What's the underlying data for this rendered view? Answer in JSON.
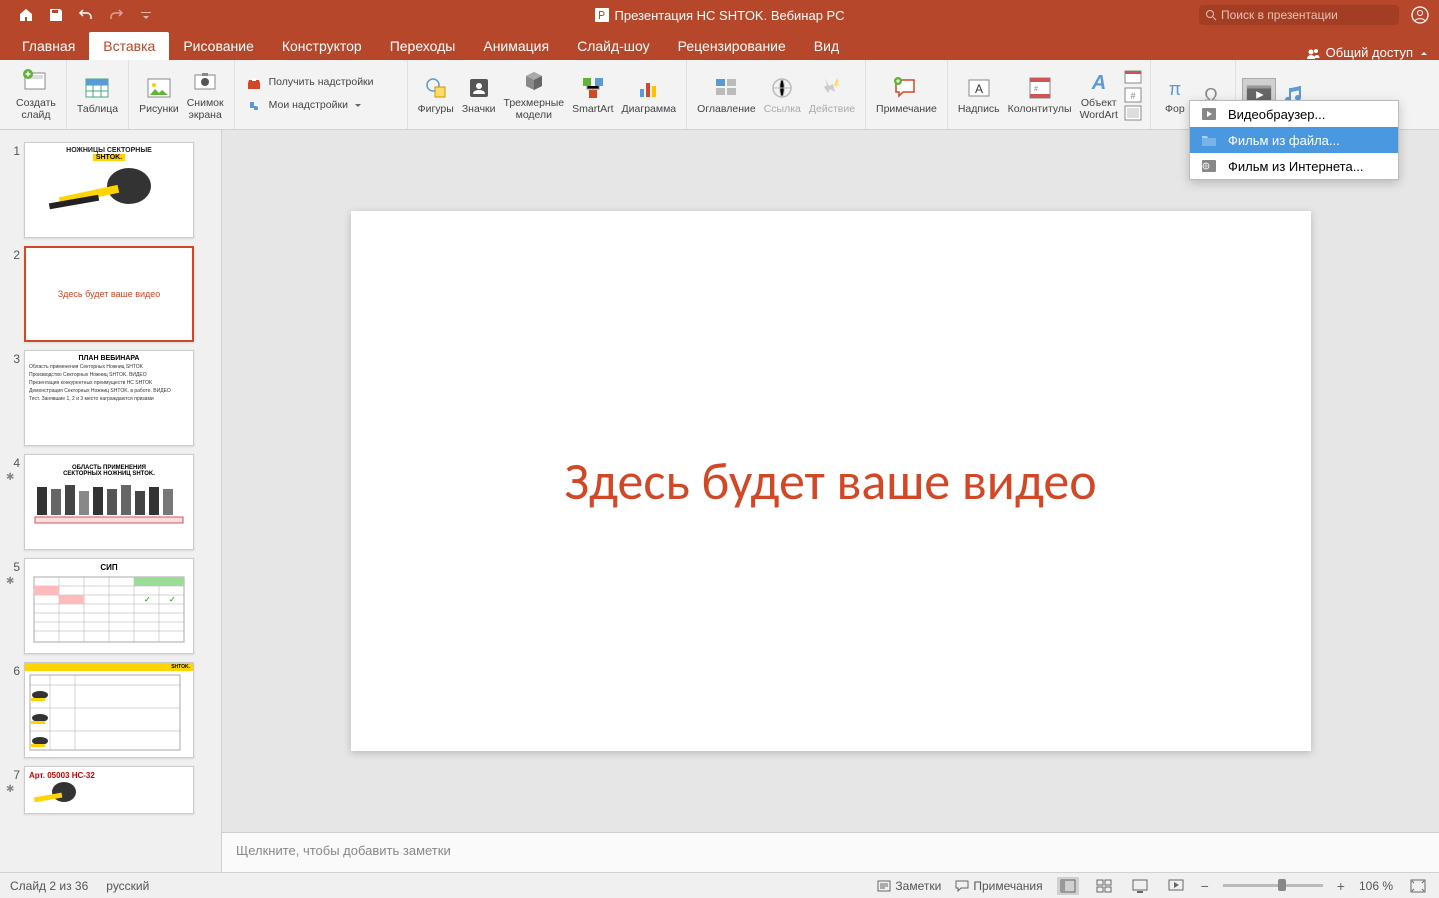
{
  "titlebar": {
    "doc_title": "Презентация НС SHTOK. Вебинар РС",
    "search_placeholder": "Поиск в презентации"
  },
  "tabs": {
    "items": [
      "Главная",
      "Вставка",
      "Рисование",
      "Конструктор",
      "Переходы",
      "Анимация",
      "Слайд-шоу",
      "Рецензирование",
      "Вид"
    ],
    "active_index": 1,
    "share": "Общий доступ"
  },
  "ribbon": {
    "new_slide": "Создать\nслайд",
    "table": "Таблица",
    "pictures": "Рисунки",
    "screenshot": "Снимок\nэкрана",
    "get_addins": "Получить надстройки",
    "my_addins": "Мои надстройки",
    "shapes": "Фигуры",
    "icons": "Значки",
    "models3d": "Трехмерные\nмодели",
    "smartart": "SmartArt",
    "chart": "Диаграмма",
    "toc": "Оглавление",
    "link": "Ссылка",
    "action": "Действие",
    "comment": "Примечание",
    "textbox": "Надпись",
    "headerfooter": "Колонтитулы",
    "wordart": "Объект\nWordArt",
    "equation": "Фор"
  },
  "dropdown": {
    "items": [
      "Видеобраузер...",
      "Фильм из файла...",
      "Фильм из Интернета..."
    ],
    "selected_index": 1
  },
  "thumbs": [
    {
      "num": "1",
      "title": "НОЖНИЦЫ СЕКТОРНЫЕ",
      "brand": "SHTOK."
    },
    {
      "num": "2",
      "text": "Здесь будет ваше видео"
    },
    {
      "num": "3",
      "title": "ПЛАН ВЕБИНАРА",
      "items": [
        "Область применения Секторных Ножниц SHTOK",
        "Производство Секторных Ножниц SHTOK. ВИДЕО",
        "Презентация конкурентных преимуществ НС SHTOK",
        "Демонстрация Секторных Ножниц SHTOK. в работе. ВИДЕО",
        "Тест. Занявшие 1, 2 и 3 место награждаются призами"
      ]
    },
    {
      "num": "4",
      "star": true,
      "title": "ОБЛАСТЬ ПРИМЕНЕНИЯ\nСЕКТОРНЫХ НОЖНИЦ SHTOK."
    },
    {
      "num": "5",
      "star": true,
      "title": "СИП"
    },
    {
      "num": "6",
      "brand": "SHTOK."
    },
    {
      "num": "7",
      "star": true,
      "art": "Арт. 05003 НС-32"
    }
  ],
  "slide": {
    "text": "Здесь будет ваше видео"
  },
  "notes": {
    "placeholder": "Щелкните, чтобы добавить заметки"
  },
  "status": {
    "slide_info": "Слайд 2 из 36",
    "language": "русский",
    "notes_btn": "Заметки",
    "comments_btn": "Примечания",
    "zoom": "106 %"
  }
}
